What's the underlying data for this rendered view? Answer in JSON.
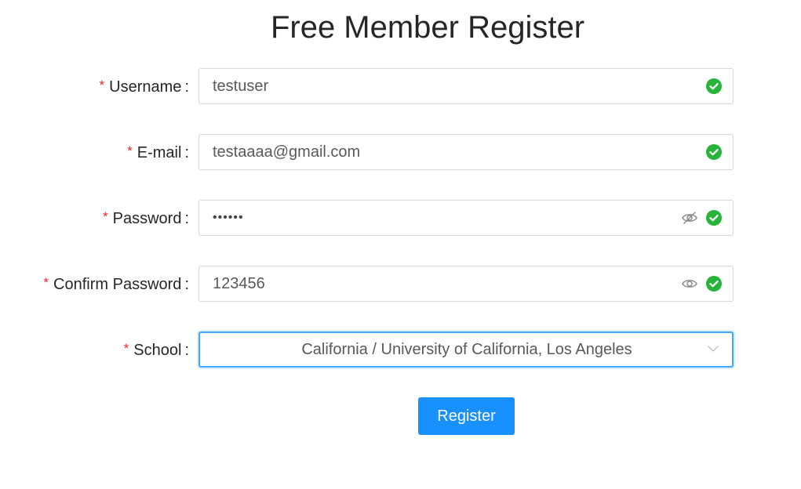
{
  "page": {
    "title": "Free Member Register"
  },
  "form": {
    "required_mark": "*",
    "colon": ":",
    "username": {
      "label": "Username",
      "value": "testuser"
    },
    "email": {
      "label": "E-mail",
      "value": "testaaaa@gmail.com"
    },
    "password": {
      "label": "Password",
      "value": "••••••",
      "visibility": "hidden"
    },
    "confirm_password": {
      "label": "Confirm Password",
      "value": "123456",
      "visibility": "visible"
    },
    "school": {
      "label": "School",
      "value": "California / University of California, Los Angeles"
    },
    "register_label": "Register"
  },
  "icons": {
    "valid": "check-circle-icon",
    "eye_hidden": "eye-invisible-icon",
    "eye_visible": "eye-icon",
    "dropdown": "chevron-down-icon"
  },
  "colors": {
    "primary": "#1890ff",
    "success": "#28b43a",
    "required": "#f5222d",
    "border": "#d9d9d9",
    "focus_border": "#40a9ff"
  }
}
